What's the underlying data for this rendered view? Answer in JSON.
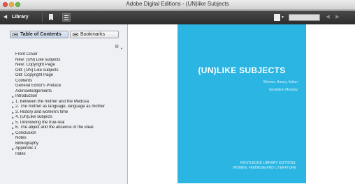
{
  "window": {
    "title": "Adobe Digital Editions - (UN)like Subjects"
  },
  "toolbar": {
    "back_icon": "back-arrow-icon",
    "library_label": "Library",
    "bookmark_icon": "bookmark-icon",
    "list_icon": "list-icon",
    "view_icon": "page-view-icon",
    "page_value": "",
    "prev_icon": "prev-page-icon",
    "next_icon": "next-page-icon"
  },
  "panel": {
    "tabs": [
      {
        "label": "Table of Contents",
        "icon": "toc-icon",
        "active": true
      },
      {
        "label": "Bookmarks",
        "icon": "bookmarks-icon",
        "active": false
      }
    ],
    "settings_icon": "gear-icon",
    "toc": [
      {
        "label": "Front Cover",
        "expandable": false
      },
      {
        "label": "New: (UN) Like subjects",
        "expandable": false
      },
      {
        "label": "New: Copyright Page",
        "expandable": false
      },
      {
        "label": "Old: (UN) Like subjects",
        "expandable": false
      },
      {
        "label": "Old: Copyright Page",
        "expandable": false
      },
      {
        "label": "Contents",
        "expandable": false
      },
      {
        "label": "General Editor's Preface",
        "expandable": false
      },
      {
        "label": "Acknowledgements",
        "expandable": false
      },
      {
        "label": "Introduction",
        "expandable": true
      },
      {
        "label": "1. Between the mother and the Medusa",
        "expandable": true
      },
      {
        "label": "2. The mother as language, language as mother",
        "expandable": true
      },
      {
        "label": "3. History and women's time",
        "expandable": true
      },
      {
        "label": "4. (Un)Like subjects",
        "expandable": true
      },
      {
        "label": "5. Unknowing the true-real",
        "expandable": true
      },
      {
        "label": "6. The abject and the absence of the ideal",
        "expandable": true
      },
      {
        "label": "Conclusion",
        "expandable": true
      },
      {
        "label": "Notes",
        "expandable": false
      },
      {
        "label": "Bibliography",
        "expandable": false
      },
      {
        "label": "Appendix 1",
        "expandable": true
      },
      {
        "label": "Index",
        "expandable": false
      }
    ]
  },
  "cover": {
    "title": "(UN)LIKE SUBJECTS",
    "subtitle": "Women, theory, fiction",
    "author": "Geraldine Meaney",
    "series_line1": "ROUTLEDGE LIBRARY EDITIONS:",
    "series_line2": "WOMEN, FEMINISM AND LITERATURE",
    "color": "#2ab5e2"
  }
}
